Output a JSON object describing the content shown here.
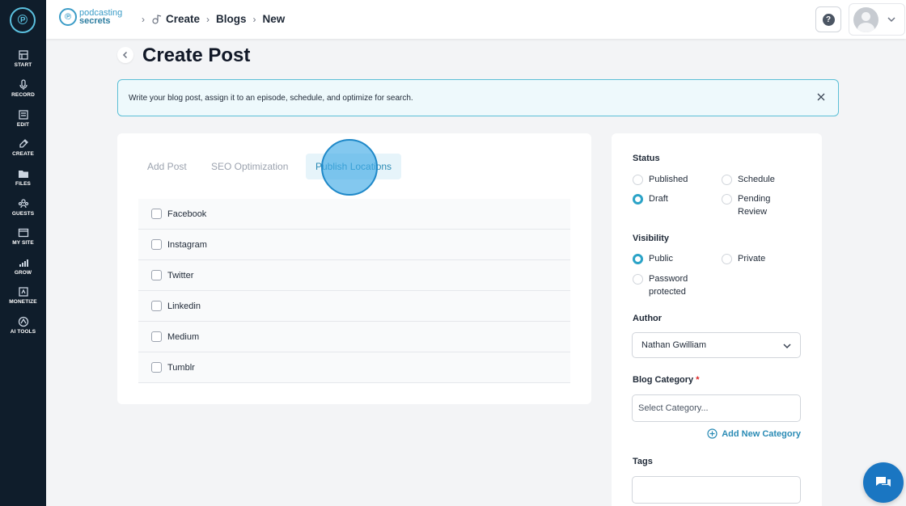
{
  "sidebar": {
    "items": [
      {
        "label": "START",
        "icon": "start-icon"
      },
      {
        "label": "RECORD",
        "icon": "microphone-icon"
      },
      {
        "label": "EDIT",
        "icon": "edit-icon"
      },
      {
        "label": "CREATE",
        "icon": "create-icon"
      },
      {
        "label": "FILES",
        "icon": "files-icon"
      },
      {
        "label": "GUESTS",
        "icon": "guests-icon"
      },
      {
        "label": "MY SITE",
        "icon": "my-site-icon"
      },
      {
        "label": "GROW",
        "icon": "grow-icon"
      },
      {
        "label": "MONETIZE",
        "icon": "monetize-icon"
      },
      {
        "label": "AI TOOLS",
        "icon": "ai-tools-icon"
      }
    ]
  },
  "topbar": {
    "brand_line1": "podcasting",
    "brand_line2": "secrets",
    "breadcrumbs": [
      "Create",
      "Blogs",
      "New"
    ],
    "help_label": "?"
  },
  "page": {
    "title": "Create Post"
  },
  "banner": {
    "text": "Write your blog post, assign it to an episode, schedule, and optimize for search."
  },
  "tabs": [
    {
      "label": "Add Post"
    },
    {
      "label": "SEO Optimization"
    },
    {
      "label": "Publish Locations"
    }
  ],
  "locations": [
    {
      "label": "Facebook"
    },
    {
      "label": "Instagram"
    },
    {
      "label": "Twitter"
    },
    {
      "label": "Linkedin"
    },
    {
      "label": "Medium"
    },
    {
      "label": "Tumblr"
    }
  ],
  "side": {
    "status_label": "Status",
    "status_options": [
      "Published",
      "Schedule",
      "Draft",
      "Pending Review"
    ],
    "status_selected": "Draft",
    "visibility_label": "Visibility",
    "visibility_options": [
      "Public",
      "Private",
      "Password protected"
    ],
    "visibility_selected": "Public",
    "author_label": "Author",
    "author_value": "Nathan Gwilliam",
    "category_label": "Blog Category",
    "category_required": "*",
    "category_placeholder": "Select Category...",
    "add_category": "Add New Category",
    "tags_label": "Tags",
    "tags_placeholder": ""
  },
  "colors": {
    "sidebar_bg": "#0f1d2b",
    "accent": "#2a8bb5",
    "banner_border": "#5bbfd6",
    "chat_bg": "#1a76c2"
  }
}
